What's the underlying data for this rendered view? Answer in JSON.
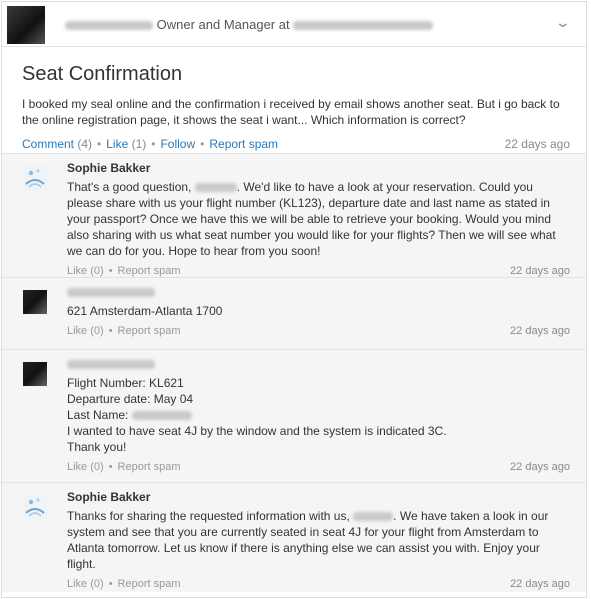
{
  "header": {
    "subtitle_prefix": "Owner and Manager at",
    "expand_icon": "chevron-down-icon"
  },
  "post": {
    "title": "Seat Confirmation",
    "body": "I booked my seal online and the confirmation i received by email shows another seat. But i go back to the online registration page, it shows the seat i want... Which information is correct?",
    "comment_label": "Comment",
    "comment_count": "(4)",
    "like_label": "Like",
    "like_count": "(1)",
    "follow_label": "Follow",
    "report_label": "Report spam",
    "time": "22 days ago"
  },
  "comments": [
    {
      "name": "Sophie Bakker",
      "text_a": "That's a good question,",
      "text_b": ". We'd like to have a look at your reservation. Could you please share with us your flight number (KL123), departure date and last name as stated in your passport? Once we have this we will be able to retrieve your booking. Would you mind also sharing with us what seat number you would like for your flights? Then we will see what we can do for you. Hope to hear from you soon!",
      "like": "Like (0)",
      "report": "Report spam",
      "time": "22 days ago"
    },
    {
      "text": "621 Amsterdam-Atlanta 1700",
      "like": "Like (0)",
      "report": "Report spam",
      "time": "22 days ago"
    },
    {
      "line1": "Flight Number: KL621",
      "line2": "Departure date: May 04",
      "line3": "Last Name:",
      "line4": "I wanted to have seat 4J by the window and the system is indicated 3C.",
      "line5": "Thank you!",
      "like": "Like (0)",
      "report": "Report spam",
      "time": "22 days ago"
    },
    {
      "name": "Sophie Bakker",
      "text_a": "Thanks for sharing the requested information with us,",
      "text_b": ". We have taken a look in our system and see that you are currently seated in seat 4J for your flight from Amsterdam to Atlanta tomorrow. Let us know if there is anything else we can assist you with. Enjoy your flight.",
      "like": "Like (0)",
      "report": "Report spam",
      "time": "22 days ago"
    }
  ]
}
